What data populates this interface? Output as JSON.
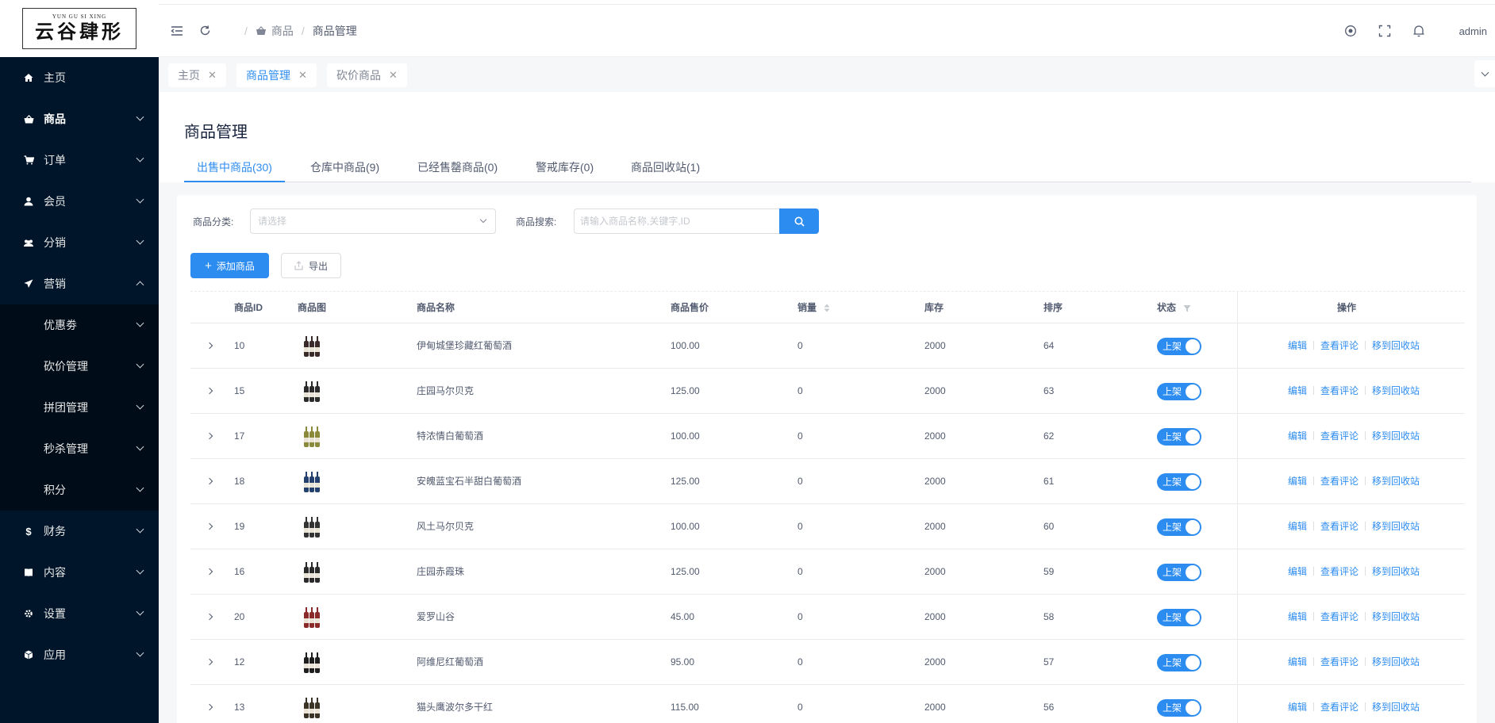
{
  "logo": {
    "en": "YUN GU SI XING",
    "cn": "云谷肆形"
  },
  "sidebar": {
    "items": [
      {
        "label": "主页",
        "icon": "home-icon",
        "expanded": false,
        "has_children": false
      },
      {
        "label": "商品",
        "icon": "shopping-basket-icon",
        "active": true,
        "has_children": true
      },
      {
        "label": "订单",
        "icon": "cart-icon",
        "has_children": true
      },
      {
        "label": "会员",
        "icon": "user-icon",
        "has_children": true
      },
      {
        "label": "分销",
        "icon": "users-icon",
        "has_children": true
      },
      {
        "label": "营销",
        "icon": "send-icon",
        "has_children": true,
        "expanded": true
      }
    ],
    "marketing_children": [
      {
        "label": "优惠劵"
      },
      {
        "label": "砍价管理"
      },
      {
        "label": "拼团管理"
      },
      {
        "label": "秒杀管理"
      },
      {
        "label": "积分"
      }
    ],
    "items_after": [
      {
        "label": "财务",
        "icon": "dollar-icon"
      },
      {
        "label": "内容",
        "icon": "book-icon"
      },
      {
        "label": "设置",
        "icon": "gear-icon"
      },
      {
        "label": "应用",
        "icon": "cube-icon"
      }
    ]
  },
  "header": {
    "breadcrumb": [
      "商品",
      "商品管理"
    ],
    "username": "admin"
  },
  "tabs": [
    {
      "label": "主页"
    },
    {
      "label": "商品管理",
      "active": true
    },
    {
      "label": "砍价商品"
    }
  ],
  "page": {
    "title": "商品管理",
    "subtabs": [
      {
        "label": "出售中商品(30)",
        "active": true
      },
      {
        "label": "仓库中商品(9)"
      },
      {
        "label": "已经售罄商品(0)"
      },
      {
        "label": "警戒库存(0)"
      },
      {
        "label": "商品回收站(1)"
      }
    ]
  },
  "filters": {
    "category_label": "商品分类:",
    "category_placeholder": "请选择",
    "search_label": "商品搜索:",
    "search_placeholder": "请输入商品名称,关键字,ID"
  },
  "toolbar": {
    "add_label": "添加商品",
    "export_label": "导出"
  },
  "table": {
    "columns": [
      "商品ID",
      "商品图",
      "商品名称",
      "商品售价",
      "销量",
      "库存",
      "排序",
      "状态",
      "操作"
    ],
    "switch_label": "上架",
    "actions": [
      "编辑",
      "查看评论",
      "移到回收站"
    ],
    "rows": [
      {
        "id": "10",
        "name": "伊甸城堡珍藏红葡萄酒",
        "price": "100.00",
        "sales": "0",
        "stock": "2000",
        "sort": "64",
        "bottle_color": "#3a2a2a"
      },
      {
        "id": "15",
        "name": "庄园马尔贝克",
        "price": "125.00",
        "sales": "0",
        "stock": "2000",
        "sort": "63",
        "bottle_color": "#2b2b2b"
      },
      {
        "id": "17",
        "name": "特浓情白葡萄酒",
        "price": "100.00",
        "sales": "0",
        "stock": "2000",
        "sort": "62",
        "bottle_color": "#8a8a3a"
      },
      {
        "id": "18",
        "name": "安魄蓝宝石半甜白葡萄酒",
        "price": "125.00",
        "sales": "0",
        "stock": "2000",
        "sort": "61",
        "bottle_color": "#23406e"
      },
      {
        "id": "19",
        "name": "风土马尔贝克",
        "price": "100.00",
        "sales": "0",
        "stock": "2000",
        "sort": "60",
        "bottle_color": "#333333"
      },
      {
        "id": "16",
        "name": "庄园赤霞珠",
        "price": "125.00",
        "sales": "0",
        "stock": "2000",
        "sort": "59",
        "bottle_color": "#2a2a2a"
      },
      {
        "id": "20",
        "name": "爱罗山谷",
        "price": "45.00",
        "sales": "0",
        "stock": "2000",
        "sort": "58",
        "bottle_color": "#8a2a2a"
      },
      {
        "id": "12",
        "name": "阿维尼红葡萄酒",
        "price": "95.00",
        "sales": "0",
        "stock": "2000",
        "sort": "57",
        "bottle_color": "#1e1e1e"
      },
      {
        "id": "13",
        "name": "猫头鹰波尔多干红",
        "price": "115.00",
        "sales": "0",
        "stock": "2000",
        "sort": "56",
        "bottle_color": "#3b3326"
      }
    ]
  },
  "colors": {
    "primary": "#2d8cf0",
    "sidebar": "#001529",
    "submenu": "#000c17"
  }
}
